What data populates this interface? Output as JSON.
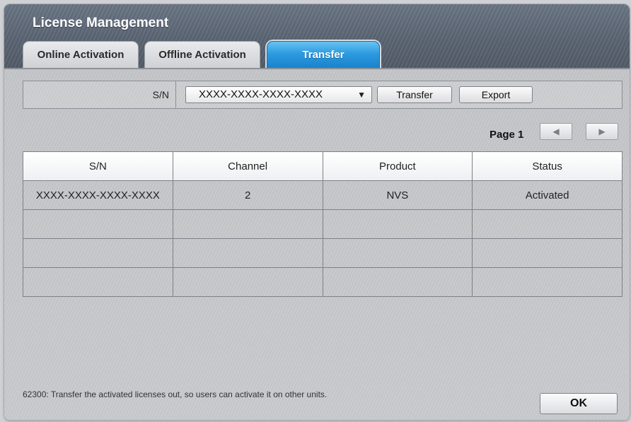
{
  "window": {
    "title": "License Management"
  },
  "tabs": [
    {
      "label": "Online Activation",
      "active": false
    },
    {
      "label": "Offline Activation",
      "active": false
    },
    {
      "label": "Transfer",
      "active": true
    }
  ],
  "serial_bar": {
    "label": "S/N",
    "selected": "XXXX-XXXX-XXXX-XXXX",
    "transfer_label": "Transfer",
    "export_label": "Export"
  },
  "pager": {
    "label": "Page 1"
  },
  "table": {
    "columns": [
      "S/N",
      "Channel",
      "Product",
      "Status"
    ],
    "rows": [
      [
        "XXXX-XXXX-XXXX-XXXX",
        "2",
        "NVS",
        "Activated"
      ],
      [
        "",
        "",
        "",
        ""
      ],
      [
        "",
        "",
        "",
        ""
      ],
      [
        "",
        "",
        "",
        ""
      ]
    ]
  },
  "footer": {
    "note": "62300: Transfer the activated licenses out, so users can activate it on other units.",
    "ok_label": "OK"
  },
  "colors": {
    "active_tab": "#2d9be0",
    "titlebar": "#5a6472"
  }
}
